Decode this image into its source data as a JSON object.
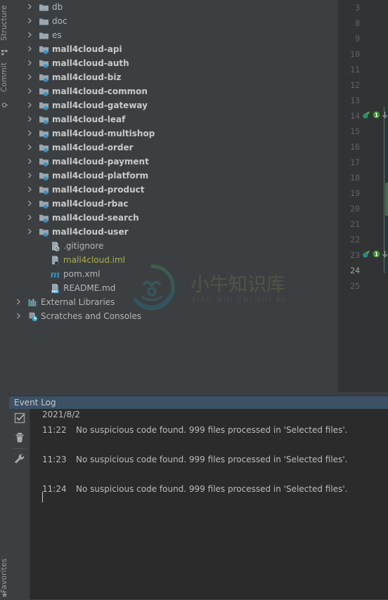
{
  "theme": {
    "panel_bg": "#3c3f41",
    "editor_bg": "#2b2b2b",
    "gutter_bg": "#313335",
    "header_bg": "#3c5066",
    "text": "#bbbbbb",
    "iml_color": "#a9b04a",
    "module_badge": "#3592c4",
    "guide_line": "#4e7a72",
    "vcs_change": "#4a6b48"
  },
  "tool_strip": {
    "tabs": [
      {
        "label": "Structure",
        "icon": "structure-icon"
      },
      {
        "label": "Commit",
        "icon": "commit-icon"
      },
      {
        "label": "Favorites",
        "icon": "star-icon"
      }
    ]
  },
  "project_tree": {
    "rows": [
      {
        "label": "db",
        "indent": 42,
        "arrow": true,
        "icon": "folder-icon",
        "style": "plain"
      },
      {
        "label": "doc",
        "indent": 42,
        "arrow": true,
        "icon": "folder-icon",
        "style": "plain"
      },
      {
        "label": "es",
        "indent": 42,
        "arrow": true,
        "icon": "folder-icon",
        "style": "plain"
      },
      {
        "label": "mall4cloud-api",
        "indent": 42,
        "arrow": true,
        "icon": "module-folder-icon",
        "style": "bold"
      },
      {
        "label": "mall4cloud-auth",
        "indent": 42,
        "arrow": true,
        "icon": "module-folder-icon",
        "style": "bold"
      },
      {
        "label": "mall4cloud-biz",
        "indent": 42,
        "arrow": true,
        "icon": "module-folder-icon",
        "style": "bold"
      },
      {
        "label": "mall4cloud-common",
        "indent": 42,
        "arrow": true,
        "icon": "module-folder-icon",
        "style": "bold"
      },
      {
        "label": "mall4cloud-gateway",
        "indent": 42,
        "arrow": true,
        "icon": "module-folder-icon",
        "style": "bold"
      },
      {
        "label": "mall4cloud-leaf",
        "indent": 42,
        "arrow": true,
        "icon": "module-folder-icon",
        "style": "bold"
      },
      {
        "label": "mall4cloud-multishop",
        "indent": 42,
        "arrow": true,
        "icon": "module-folder-icon",
        "style": "bold"
      },
      {
        "label": "mall4cloud-order",
        "indent": 42,
        "arrow": true,
        "icon": "module-folder-icon",
        "style": "bold"
      },
      {
        "label": "mall4cloud-payment",
        "indent": 42,
        "arrow": true,
        "icon": "module-folder-icon",
        "style": "bold"
      },
      {
        "label": "mall4cloud-platform",
        "indent": 42,
        "arrow": true,
        "icon": "module-folder-icon",
        "style": "bold"
      },
      {
        "label": "mall4cloud-product",
        "indent": 42,
        "arrow": true,
        "icon": "module-folder-icon",
        "style": "bold"
      },
      {
        "label": "mall4cloud-rbac",
        "indent": 42,
        "arrow": true,
        "icon": "module-folder-icon",
        "style": "bold"
      },
      {
        "label": "mall4cloud-search",
        "indent": 42,
        "arrow": true,
        "icon": "module-folder-icon",
        "style": "bold"
      },
      {
        "label": "mall4cloud-user",
        "indent": 42,
        "arrow": true,
        "icon": "module-folder-icon",
        "style": "bold"
      },
      {
        "label": ".gitignore",
        "indent": 58,
        "arrow": false,
        "icon": "gitignore-file-icon",
        "style": "plain"
      },
      {
        "label": "mall4cloud.iml",
        "indent": 58,
        "arrow": false,
        "icon": "iml-file-icon",
        "style": "iml"
      },
      {
        "label": "pom.xml",
        "indent": 58,
        "arrow": false,
        "icon": "maven-file-icon",
        "style": "plain"
      },
      {
        "label": "README.md",
        "indent": 58,
        "arrow": false,
        "icon": "markdown-file-icon",
        "style": "plain"
      },
      {
        "label": "External Libraries",
        "indent": 26,
        "arrow": true,
        "icon": "libraries-icon",
        "style": "plain"
      },
      {
        "label": "Scratches and Consoles",
        "indent": 26,
        "arrow": true,
        "icon": "scratches-icon",
        "style": "plain"
      }
    ]
  },
  "watermark": {
    "text_main": "小牛知识库",
    "text_sub": "XIAO NIU ZHI SHI KU"
  },
  "editor": {
    "line_numbers": [
      {
        "n": "3",
        "current": false,
        "marks": false
      },
      {
        "n": "8",
        "current": false,
        "marks": false
      },
      {
        "n": "9",
        "current": false,
        "marks": false
      },
      {
        "n": "10",
        "current": false,
        "marks": false
      },
      {
        "n": "11",
        "current": false,
        "marks": false
      },
      {
        "n": "12",
        "current": false,
        "marks": false
      },
      {
        "n": "13",
        "current": false,
        "marks": false
      },
      {
        "n": "14",
        "current": false,
        "marks": true
      },
      {
        "n": "15",
        "current": false,
        "marks": false
      },
      {
        "n": "16",
        "current": false,
        "marks": false
      },
      {
        "n": "17",
        "current": false,
        "marks": false
      },
      {
        "n": "18",
        "current": false,
        "marks": false
      },
      {
        "n": "19",
        "current": false,
        "marks": false
      },
      {
        "n": "20",
        "current": false,
        "marks": false
      },
      {
        "n": "21",
        "current": false,
        "marks": false
      },
      {
        "n": "22",
        "current": false,
        "marks": false
      },
      {
        "n": "23",
        "current": false,
        "marks": true
      },
      {
        "n": "24",
        "current": true,
        "marks": false
      },
      {
        "n": "25",
        "current": false,
        "marks": false
      }
    ],
    "gutter_marks": {
      "bean_icon": "spring-bean-icon",
      "usage_count": "1",
      "override_icon": "implementing-method-icon"
    }
  },
  "event_log": {
    "title": "Event Log",
    "toolbar": [
      {
        "name": "mark-all-read-button",
        "icon": "checkbox-icon"
      },
      {
        "name": "delete-button",
        "icon": "trash-icon"
      },
      {
        "name": "settings-button",
        "icon": "wrench-icon"
      }
    ],
    "date": "2021/8/2",
    "entries": [
      {
        "time": "11:22",
        "message": "No suspicious code found. 999 files processed in 'Selected files'."
      },
      {
        "time": "11:23",
        "message": "No suspicious code found. 999 files processed in 'Selected files'."
      },
      {
        "time": "11:24",
        "message": "No suspicious code found. 999 files processed in 'Selected files'."
      }
    ]
  }
}
